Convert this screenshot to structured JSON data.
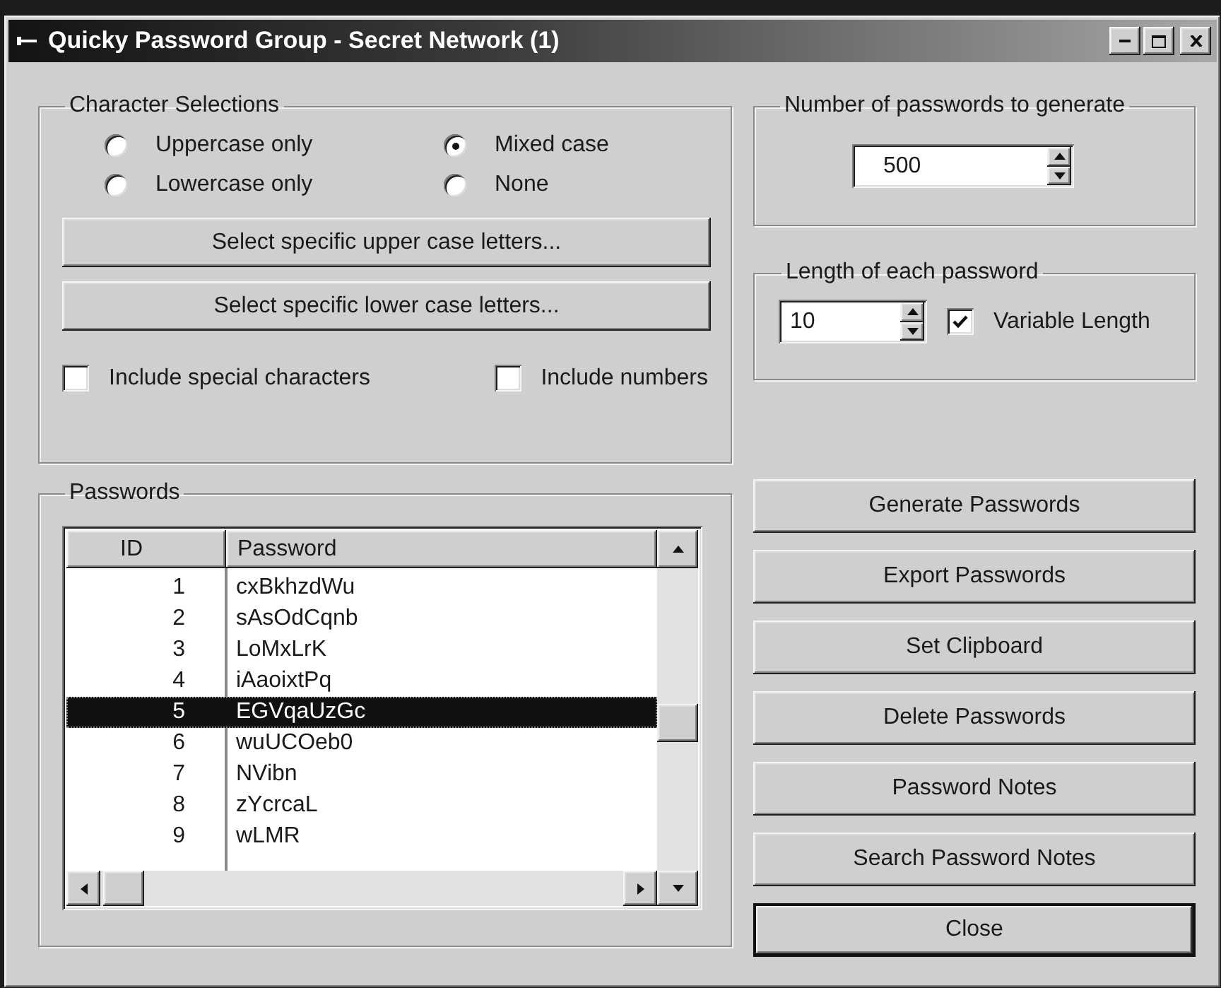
{
  "window": {
    "title": "Quicky Password Group - Secret Network (1)"
  },
  "character_selections": {
    "label": "Character Selections",
    "options": [
      {
        "label": "Uppercase only",
        "selected": false
      },
      {
        "label": "Mixed case",
        "selected": true
      },
      {
        "label": "Lowercase only",
        "selected": false
      },
      {
        "label": "None",
        "selected": false
      }
    ],
    "buttons": [
      "Select specific upper case letters...",
      "Select specific lower case letters..."
    ],
    "checkboxes": [
      {
        "label": "Include special characters",
        "checked": false
      },
      {
        "label": "Include numbers",
        "checked": false
      }
    ]
  },
  "count": {
    "label": "Number of passwords to generate",
    "value": "500"
  },
  "length": {
    "label": "Length of each password",
    "value": "10",
    "variable": {
      "label": "Variable Length",
      "checked": true
    }
  },
  "passwords": {
    "label": "Passwords",
    "columns": [
      "ID",
      "Password"
    ],
    "rows": [
      {
        "id": "1",
        "password": "cxBkhzdWu",
        "selected": false
      },
      {
        "id": "2",
        "password": "sAsOdCqnb",
        "selected": false
      },
      {
        "id": "3",
        "password": "LoMxLrK",
        "selected": false
      },
      {
        "id": "4",
        "password": "iAaoixtPq",
        "selected": false
      },
      {
        "id": "5",
        "password": "EGVqaUzGc",
        "selected": true
      },
      {
        "id": "6",
        "password": "wuUCOeb0",
        "selected": false
      },
      {
        "id": "7",
        "password": "NVibn",
        "selected": false
      },
      {
        "id": "8",
        "password": "zYcrcaL",
        "selected": false
      },
      {
        "id": "9",
        "password": "wLMR",
        "selected": false
      }
    ]
  },
  "buttons": [
    {
      "label": "Generate Passwords",
      "default": false
    },
    {
      "label": "Export Passwords",
      "default": false
    },
    {
      "label": "Set Clipboard",
      "default": false
    },
    {
      "label": "Delete Passwords",
      "default": false
    },
    {
      "label": "Password Notes",
      "default": false
    },
    {
      "label": "Search Password Notes",
      "default": false
    },
    {
      "label": "Close",
      "default": true
    }
  ]
}
